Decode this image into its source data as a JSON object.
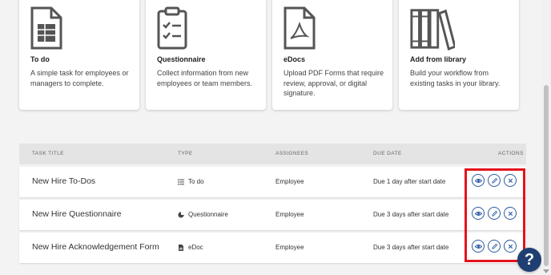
{
  "cards": [
    {
      "title": "To do",
      "desc": "A simple task for employees or managers to complete.",
      "icon": "spreadsheet-icon"
    },
    {
      "title": "Questionnaire",
      "desc": "Collect information from new employees or team members.",
      "icon": "clipboard-checklist-icon"
    },
    {
      "title": "eDocs",
      "desc": "Upload PDF Forms that require review, approval, or digital signature.",
      "icon": "pdf-document-icon"
    },
    {
      "title": "Add from library",
      "desc": "Build your workflow from existing tasks in your library.",
      "icon": "library-books-icon"
    }
  ],
  "table": {
    "headers": {
      "title": "TASK TITLE",
      "type": "TYPE",
      "assignees": "ASSIGNEES",
      "due": "DUE DATE",
      "actions": "ACTIONS"
    },
    "rows": [
      {
        "name": "New Hire To-Dos",
        "type": "To do",
        "type_icon": "list-icon",
        "assignee": "Employee",
        "due": "Due 1 day after start date"
      },
      {
        "name": "New Hire Questionnaire",
        "type": "Questionnaire",
        "type_icon": "pie-chart-icon",
        "assignee": "Employee",
        "due": "Due 3 days after start date"
      },
      {
        "name": "New Hire Acknowledgement Form",
        "type": "eDoc",
        "type_icon": "document-icon",
        "assignee": "Employee",
        "due": "Due 3 days after start date"
      }
    ]
  },
  "help": {
    "label": "?"
  },
  "colors": {
    "accent": "#2c5aa0",
    "highlight": "#e3131b",
    "help_bg": "#1f3f72"
  }
}
